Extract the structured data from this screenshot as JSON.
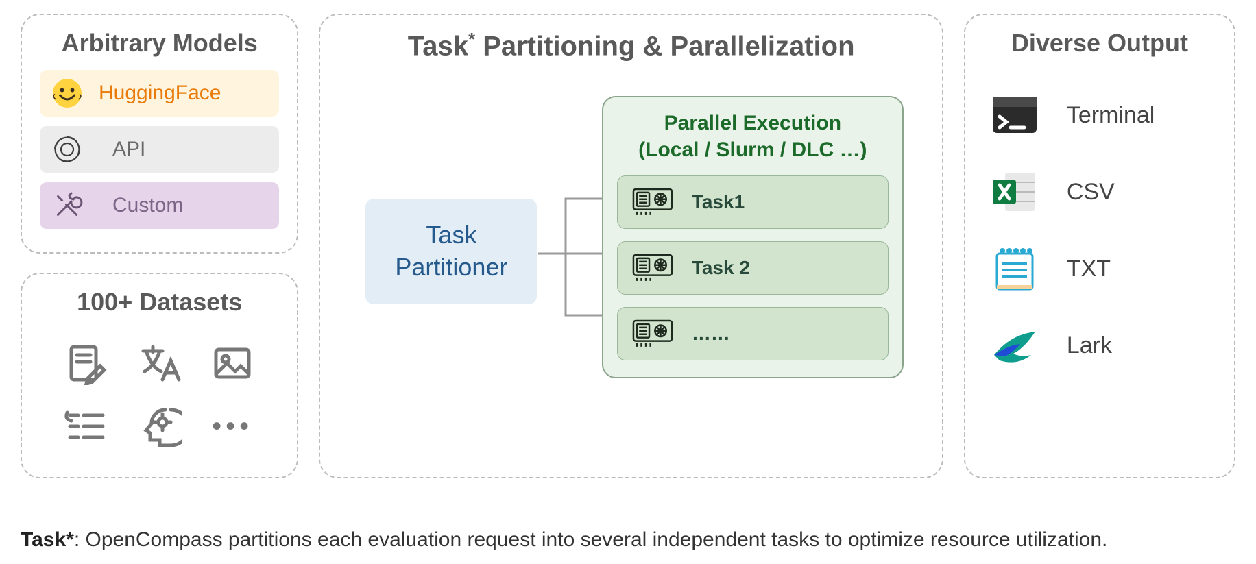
{
  "left": {
    "models_title": "Arbitrary Models",
    "items": [
      {
        "label": "HuggingFace",
        "icon": "hugging-face-icon"
      },
      {
        "label": "API",
        "icon": "openai-icon"
      },
      {
        "label": "Custom",
        "icon": "tools-icon"
      }
    ],
    "datasets_title": "100+ Datasets"
  },
  "center": {
    "title_prefix": "Task",
    "title_sup": "*",
    "title_suffix": " Partitioning & Parallelization",
    "partitioner_line1": "Task",
    "partitioner_line2": "Partitioner",
    "exec_title_line1": "Parallel Execution",
    "exec_title_line2": "(Local / Slurm / DLC …)",
    "tasks": [
      {
        "label": "Task1"
      },
      {
        "label": "Task 2"
      },
      {
        "label": "……"
      }
    ]
  },
  "right": {
    "title": "Diverse Output",
    "items": [
      {
        "label": "Terminal",
        "icon": "terminal-icon"
      },
      {
        "label": "CSV",
        "icon": "excel-icon"
      },
      {
        "label": "TXT",
        "icon": "notepad-icon"
      },
      {
        "label": "Lark",
        "icon": "lark-icon"
      }
    ]
  },
  "footnote": {
    "bold": "Task*",
    "text": ": OpenCompass partitions each evaluation request into several independent tasks to optimize resource utilization."
  }
}
